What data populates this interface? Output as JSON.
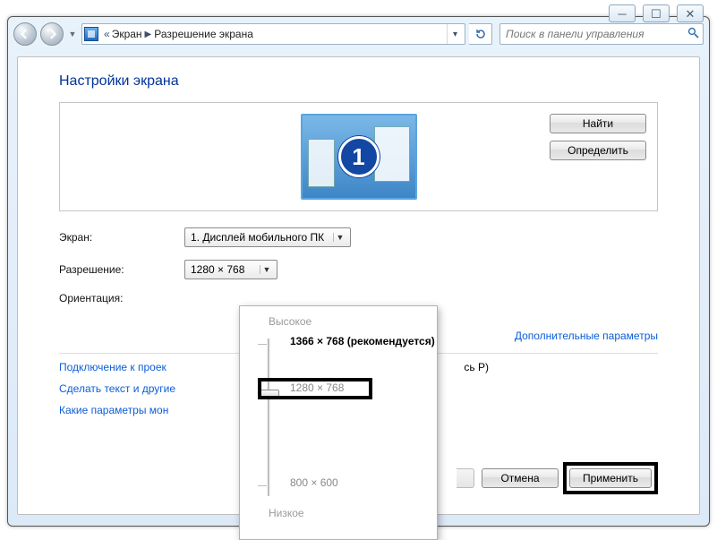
{
  "window": {
    "minimize": "─",
    "maximize": "☐",
    "close": "✕"
  },
  "addressbar": {
    "chevrons": "«",
    "crumb1": "Экран",
    "crumb2": "Разрешение экрана",
    "search_placeholder": "Поиск в панели управления"
  },
  "page": {
    "title": "Настройки экрана",
    "detect": "Найти",
    "identify": "Определить",
    "monitor_number": "1",
    "labels": {
      "display": "Экран:",
      "resolution": "Разрешение:",
      "orientation": "Ориентация:"
    },
    "values": {
      "display": "1. Дисплей мобильного ПК",
      "resolution": "1280 × 768"
    },
    "advanced": "Дополнительные параметры",
    "links": {
      "projector": "Подключение к проек",
      "projector_suffix": "сь P)",
      "textsize": "Сделать текст и другие",
      "whichmon": "Какие параметры мон"
    },
    "buttons": {
      "cancel": "Отмена",
      "apply": "Применить"
    }
  },
  "slider": {
    "high": "Высокое",
    "low": "Низкое",
    "recommended": "1366 × 768 (рекомендуется)",
    "selected": "1280 × 768",
    "lowest": "800 × 600"
  }
}
